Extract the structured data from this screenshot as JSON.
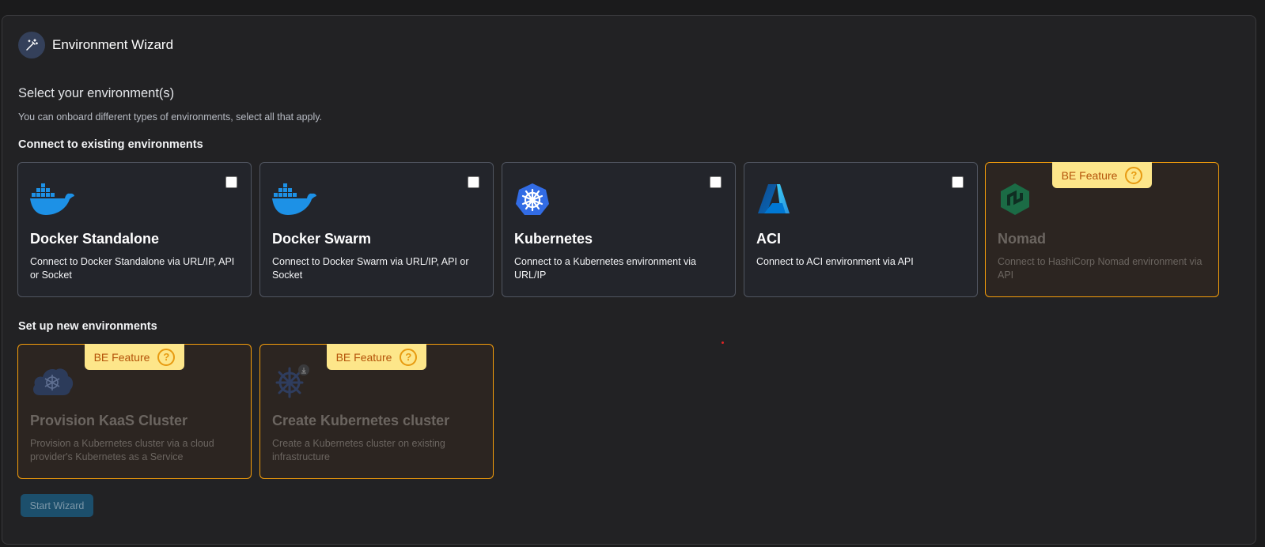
{
  "header": {
    "title": "Environment Wizard",
    "icon": "magic-wand-icon"
  },
  "intro": {
    "title": "Select your environment(s)",
    "subtitle": "You can onboard different types of environments, select all that apply."
  },
  "existing": {
    "title": "Connect to existing environments",
    "cards": [
      {
        "name": "Docker Standalone",
        "desc": "Connect to Docker Standalone via URL/IP, API or Socket",
        "icon": "docker-icon",
        "checked": false
      },
      {
        "name": "Docker Swarm",
        "desc": "Connect to Docker Swarm via URL/IP, API or Socket",
        "icon": "docker-icon",
        "checked": false
      },
      {
        "name": "Kubernetes",
        "desc": "Connect to a Kubernetes environment via URL/IP",
        "icon": "kubernetes-icon",
        "checked": false
      },
      {
        "name": "ACI",
        "desc": "Connect to ACI environment via API",
        "icon": "azure-icon",
        "checked": false
      },
      {
        "name": "Nomad",
        "desc": "Connect to HashiCorp Nomad environment via API",
        "icon": "nomad-icon",
        "badge": "BE Feature"
      }
    ]
  },
  "new_envs": {
    "title": "Set up new environments",
    "cards": [
      {
        "name": "Provision KaaS Cluster",
        "desc": "Provision a Kubernetes cluster via a cloud provider's Kubernetes as a Service",
        "icon": "cloud-kubernetes-icon",
        "badge": "BE Feature"
      },
      {
        "name": "Create Kubernetes cluster",
        "desc": "Create a Kubernetes cluster on existing infrastructure",
        "icon": "kubernetes-install-icon",
        "badge": "BE Feature"
      }
    ]
  },
  "badge_help": "?",
  "start_button": "Start Wizard",
  "colors": {
    "accent_orange": "#f59e0b",
    "badge_bg": "#fde68a",
    "docker_blue": "#1d91e6",
    "k8s_blue": "#326ce5"
  }
}
